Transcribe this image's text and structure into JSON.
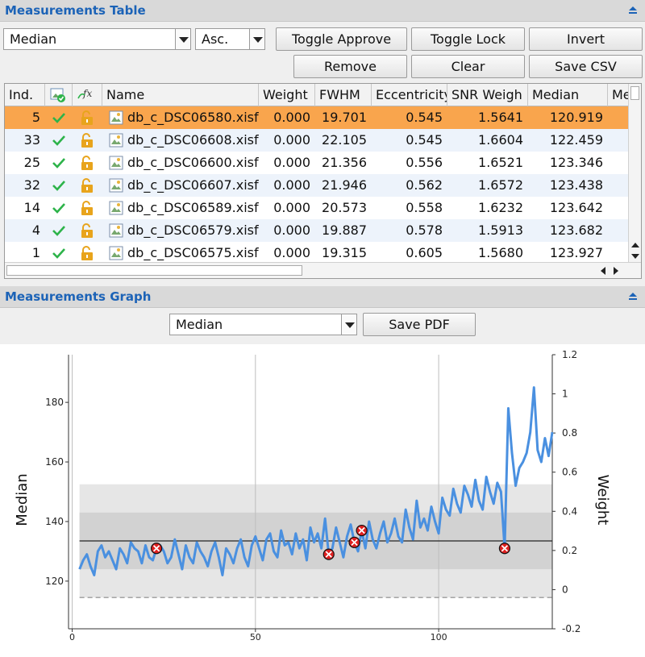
{
  "table_section": {
    "title": "Measurements Table"
  },
  "table_controls": {
    "sort_field": "Median",
    "sort_order": "Asc.",
    "buttons": {
      "toggle_approve": "Toggle Approve",
      "toggle_lock": "Toggle Lock",
      "invert": "Invert",
      "remove": "Remove",
      "clear": "Clear",
      "save_csv": "Save CSV"
    }
  },
  "table": {
    "columns": [
      "Ind.",
      "",
      "",
      "Name",
      "Weight",
      "FWHM",
      "Eccentricity",
      "SNR Weigh",
      "Median",
      "Me"
    ],
    "rows": [
      {
        "ind": "5",
        "name": "db_c_DSC06580.xisf",
        "weight": "0.000",
        "fwhm": "19.701",
        "ecc": "0.545",
        "snr": "1.5641",
        "median": "120.919"
      },
      {
        "ind": "33",
        "name": "db_c_DSC06608.xisf",
        "weight": "0.000",
        "fwhm": "22.105",
        "ecc": "0.545",
        "snr": "1.6604",
        "median": "122.459"
      },
      {
        "ind": "25",
        "name": "db_c_DSC06600.xisf",
        "weight": "0.000",
        "fwhm": "21.356",
        "ecc": "0.556",
        "snr": "1.6521",
        "median": "123.346"
      },
      {
        "ind": "32",
        "name": "db_c_DSC06607.xisf",
        "weight": "0.000",
        "fwhm": "21.946",
        "ecc": "0.562",
        "snr": "1.6572",
        "median": "123.438"
      },
      {
        "ind": "14",
        "name": "db_c_DSC06589.xisf",
        "weight": "0.000",
        "fwhm": "20.573",
        "ecc": "0.558",
        "snr": "1.6232",
        "median": "123.642"
      },
      {
        "ind": "4",
        "name": "db_c_DSC06579.xisf",
        "weight": "0.000",
        "fwhm": "19.887",
        "ecc": "0.578",
        "snr": "1.5913",
        "median": "123.682"
      },
      {
        "ind": "1",
        "name": "db_c_DSC06575.xisf",
        "weight": "0.000",
        "fwhm": "19.315",
        "ecc": "0.605",
        "snr": "1.5680",
        "median": "123.927"
      }
    ]
  },
  "graph_section": {
    "title": "Measurements Graph"
  },
  "graph_controls": {
    "property": "Median",
    "save_pdf": "Save PDF"
  },
  "icons": {
    "approved": "check-icon",
    "locked": "lock-open-icon",
    "image": "image-file-icon",
    "approved_header": "approved-image-icon",
    "locked_header": "formula-lock-icon"
  },
  "colors": {
    "series": "#4a90e0",
    "selected_row": "#f9a54d",
    "alt_row": "#edf3fb",
    "accent": "#1c63b7",
    "check": "#2db34a",
    "lock": "#e8a41c"
  },
  "chart_data": {
    "type": "line",
    "xlabel": "",
    "ylabel": "Median",
    "y2label": "Weight",
    "xlim": [
      -1,
      131
    ],
    "ylim": [
      104,
      196
    ],
    "y2lim": [
      -0.2,
      1.2
    ],
    "xticks": [
      "0",
      "50",
      "100"
    ],
    "yticks": [
      "120",
      "140",
      "160",
      "180"
    ],
    "y2ticks": [
      "-0.2",
      "0",
      "0.2",
      "0.4",
      "0.6",
      "0.8",
      "1",
      "1.2"
    ],
    "grid": true,
    "bands": {
      "median": 133.5,
      "inner": [
        124,
        143
      ],
      "outer": [
        114.5,
        152.5
      ],
      "baseline": 114.5
    },
    "series": [
      {
        "values": [
          124,
          127,
          129,
          125,
          122,
          130,
          132,
          128,
          130,
          127,
          124,
          131,
          129,
          126,
          133,
          131,
          130,
          126,
          132,
          128,
          127,
          131,
          132,
          130,
          126,
          128,
          134,
          129,
          124,
          132,
          128,
          126,
          133,
          130,
          128,
          125,
          130,
          133,
          128,
          122,
          131,
          129,
          126,
          131,
          134,
          128,
          125,
          132,
          135,
          131,
          127,
          134,
          136,
          130,
          128,
          137,
          132,
          133,
          129,
          136,
          131,
          134,
          127,
          138,
          133,
          136,
          131,
          141,
          129,
          131,
          138,
          133,
          128,
          135,
          139,
          133,
          130,
          137,
          131,
          140,
          134,
          131,
          136,
          140,
          133,
          136,
          141,
          135,
          133,
          144,
          138,
          134,
          147,
          138,
          141,
          137,
          145,
          140,
          136,
          148,
          144,
          142,
          151,
          146,
          143,
          152,
          149,
          145,
          154,
          147,
          144,
          155,
          150,
          146,
          153,
          150,
          131,
          178,
          163,
          152,
          158,
          160,
          163,
          170,
          185,
          164,
          160,
          168,
          162,
          170
        ],
        "rejected_x": [
          23,
          70,
          77,
          79,
          118
        ]
      }
    ]
  }
}
